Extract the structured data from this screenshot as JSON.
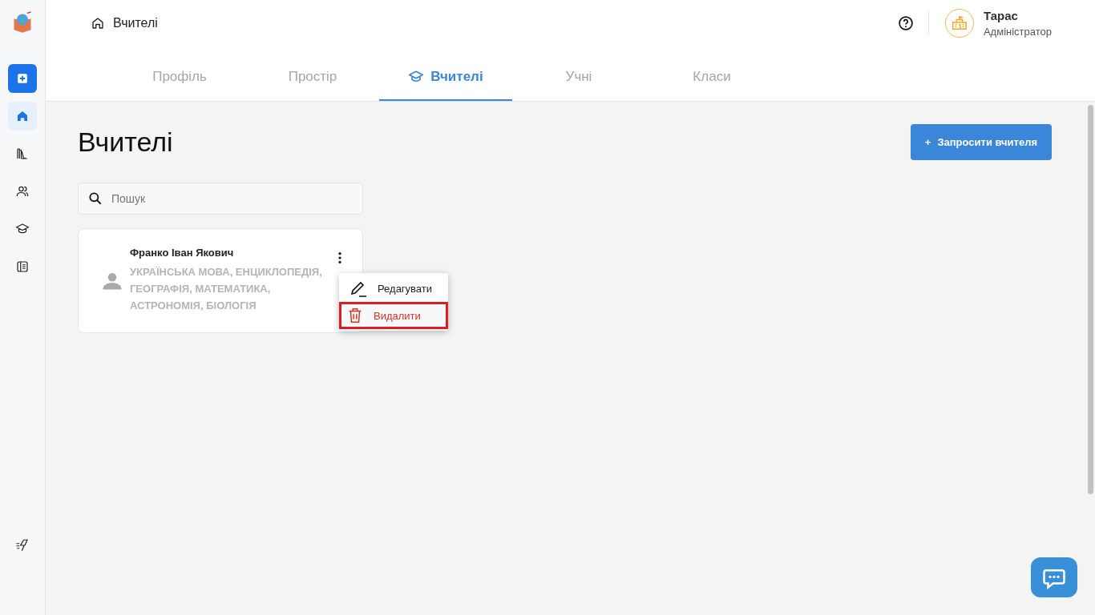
{
  "sidebar": {
    "items": [
      {
        "kind": "home",
        "selected": true
      },
      {
        "kind": "library",
        "selected": false
      },
      {
        "kind": "users",
        "selected": false
      },
      {
        "kind": "cap",
        "selected": false
      },
      {
        "kind": "journal",
        "selected": false
      }
    ]
  },
  "breadcrumb": "Вчителі",
  "user": {
    "name": "Тарас",
    "role": "Адміністратор"
  },
  "tabs": [
    {
      "label": "Профіль",
      "selected": false
    },
    {
      "label": "Простір",
      "selected": false
    },
    {
      "label": "Вчителі",
      "selected": true
    },
    {
      "label": "Учні",
      "selected": false
    },
    {
      "label": "Класи",
      "selected": false
    }
  ],
  "page_title": "Вчителі",
  "invite_button": {
    "icon": "+",
    "label": "Запросити вчителя"
  },
  "search": {
    "placeholder": "Пошук"
  },
  "teachers": [
    {
      "name": "Франко Іван Якович",
      "subjects": "УКРАЇНСЬКА МОВА, ЕНЦИКЛОПЕДІЯ, ГЕОГРАФІЯ, МАТЕМАТИКА, АСТРОНОМІЯ, БІОЛОГІЯ"
    }
  ],
  "menu": [
    {
      "kind": "edit",
      "label": "Редагувати",
      "highlighted": false
    },
    {
      "kind": "delete",
      "label": "Видалити",
      "highlighted": true
    }
  ]
}
